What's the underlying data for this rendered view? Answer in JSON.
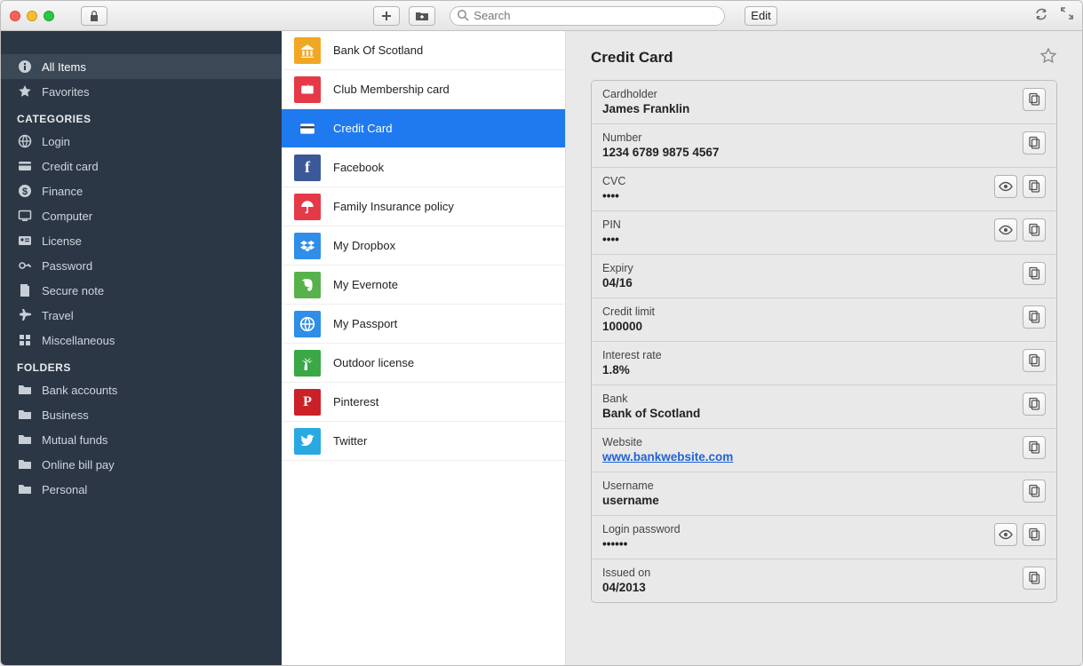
{
  "toolbar": {
    "search_placeholder": "Search",
    "edit_label": "Edit"
  },
  "sidebar": {
    "top": [
      {
        "icon": "info",
        "label": "All Items",
        "selected": true
      },
      {
        "icon": "star",
        "label": "Favorites"
      }
    ],
    "categories_heading": "CATEGORIES",
    "categories": [
      {
        "icon": "globe",
        "label": "Login"
      },
      {
        "icon": "card",
        "label": "Credit card"
      },
      {
        "icon": "dollar",
        "label": "Finance"
      },
      {
        "icon": "monitor",
        "label": "Computer"
      },
      {
        "icon": "idcard",
        "label": "License"
      },
      {
        "icon": "key",
        "label": "Password"
      },
      {
        "icon": "note",
        "label": "Secure note"
      },
      {
        "icon": "plane",
        "label": "Travel"
      },
      {
        "icon": "grid",
        "label": "Miscellaneous"
      }
    ],
    "folders_heading": "FOLDERS",
    "folders": [
      {
        "icon": "folder",
        "label": "Bank accounts"
      },
      {
        "icon": "folder",
        "label": "Business"
      },
      {
        "icon": "folder",
        "label": "Mutual funds"
      },
      {
        "icon": "folder",
        "label": "Online bill pay"
      },
      {
        "icon": "folder",
        "label": "Personal"
      }
    ]
  },
  "list": {
    "items": [
      {
        "color": "#f2a724",
        "glyph": "bank",
        "label": "Bank Of Scotland"
      },
      {
        "color": "#e53948",
        "glyph": "ticket",
        "label": "Club Membership card"
      },
      {
        "color": "#1f7af0",
        "glyph": "card",
        "label": "Credit Card",
        "selected": true
      },
      {
        "color": "#3b5998",
        "glyph": "f",
        "label": "Facebook"
      },
      {
        "color": "#e53948",
        "glyph": "umbrella",
        "label": "Family Insurance policy"
      },
      {
        "color": "#2f8ee7",
        "glyph": "dropbox",
        "label": "My Dropbox"
      },
      {
        "color": "#57b24b",
        "glyph": "evernote",
        "label": "My Evernote"
      },
      {
        "color": "#2f8ee7",
        "glyph": "globe",
        "label": "My Passport"
      },
      {
        "color": "#39a845",
        "glyph": "palm",
        "label": "Outdoor license"
      },
      {
        "color": "#cb2027",
        "glyph": "p",
        "label": "Pinterest"
      },
      {
        "color": "#29a9e1",
        "glyph": "twitter",
        "label": "Twitter"
      }
    ]
  },
  "detail": {
    "title": "Credit Card",
    "fields": [
      {
        "label": "Cardholder",
        "value": "James Franklin",
        "copy": true
      },
      {
        "label": "Number",
        "value": "1234 6789 9875 4567",
        "copy": true
      },
      {
        "label": "CVC",
        "value": "••••",
        "reveal": true,
        "copy": true
      },
      {
        "label": "PIN",
        "value": "••••",
        "reveal": true,
        "copy": true
      },
      {
        "label": "Expiry",
        "value": "04/16",
        "copy": true
      },
      {
        "label": "Credit limit",
        "value": "100000",
        "copy": true
      },
      {
        "label": "Interest rate",
        "value": "1.8%",
        "copy": true
      },
      {
        "label": "Bank",
        "value": "Bank of Scotland",
        "copy": true
      },
      {
        "label": "Website",
        "value": "www.bankwebsite.com",
        "link": true,
        "copy": true
      },
      {
        "label": "Username",
        "value": "username",
        "copy": true
      },
      {
        "label": "Login password",
        "value": "••••••",
        "reveal": true,
        "copy": true
      },
      {
        "label": "Issued on",
        "value": "04/2013",
        "copy": true
      }
    ]
  }
}
